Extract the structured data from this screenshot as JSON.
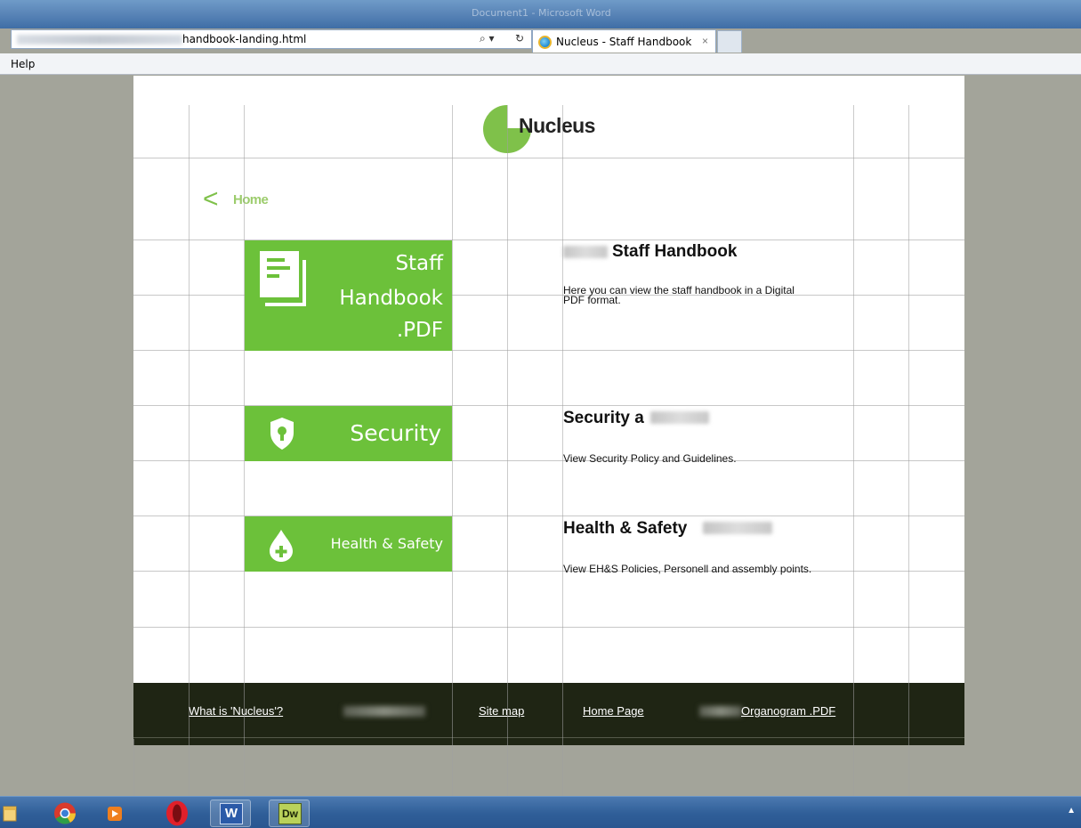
{
  "browser": {
    "window_title": "Document1 - Microsoft Word",
    "address_url": "handbook-landing.html",
    "address_controls": {
      "search": "⌕ ▾",
      "refresh": "↻"
    },
    "tab_title": "Nucleus - Staff Handbook",
    "tab_close": "×",
    "menu": [
      "Help"
    ]
  },
  "header": {
    "logo_text": "Nucleus",
    "logo_color": "#7fc14a"
  },
  "nav": {
    "back_chevron": "<",
    "home_label": "Home"
  },
  "tiles": {
    "handbook": {
      "lines": [
        "Staff",
        "Handbook",
        ".PDF"
      ],
      "icon": "document-stack-icon"
    },
    "security": {
      "label": "Security",
      "icon": "shield-lock-icon"
    },
    "health": {
      "label": "Health & Safety",
      "icon": "drop-plus-icon"
    },
    "color": "#6cc13a"
  },
  "sections": {
    "handbook": {
      "title": "Staff Handbook",
      "description_1": "Here you can view the staff handbook in a Digital",
      "description_2": "PDF format."
    },
    "security": {
      "title": "Security a",
      "description": "View Security Policy and Guidelines."
    },
    "health": {
      "title": "Health & Safety",
      "description": "View EH&S Policies, Personell and assembly points."
    }
  },
  "footer": {
    "what_is": "What is 'Nucleus'?",
    "site_map": "Site map",
    "home_page": "Home Page",
    "organogram": "Organogram .PDF",
    "background": "#1f2514"
  },
  "taskbar": {
    "apps": [
      "explorer-icon",
      "chrome-icon",
      "media-player-icon",
      "opera-icon",
      "word-icon",
      "dreamweaver-icon"
    ],
    "word_label": "W",
    "dreamweaver_label": "Dw",
    "tray_arrow": "▲"
  }
}
